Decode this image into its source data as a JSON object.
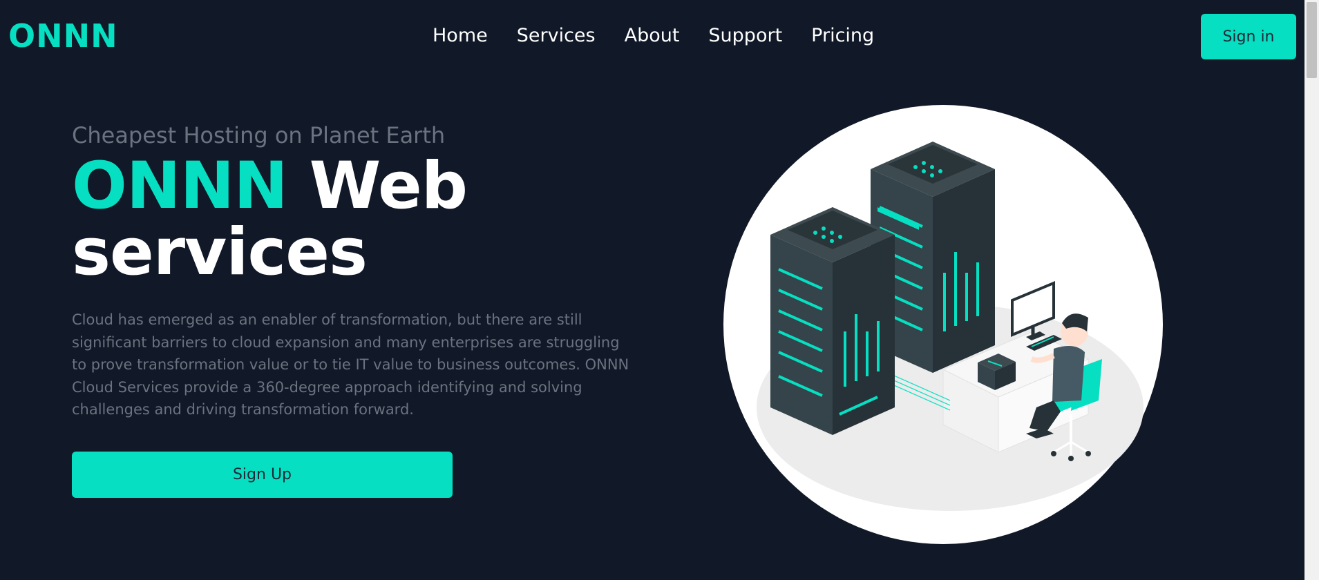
{
  "colors": {
    "accent": "#06dfc1",
    "background": "#111827",
    "text_muted": "#6b7280",
    "button_text": "#1f2937"
  },
  "header": {
    "logo": "ONNN",
    "nav": [
      "Home",
      "Services",
      "About",
      "Support",
      "Pricing"
    ],
    "signin_label": "Sign in"
  },
  "hero": {
    "tagline": "Cheapest Hosting on Planet Earth",
    "headline_brand": "ONNN",
    "headline_rest_1": "Web",
    "headline_rest_2": "services",
    "description": "Cloud has emerged as an enabler of transformation, but there are still significant barriers to cloud expansion and many enterprises are struggling to prove transformation value or to tie IT value to business outcomes. ONNN Cloud Services provide a 360-degree approach identifying and solving challenges and driving transformation forward.",
    "signup_label": "Sign Up"
  },
  "illustration": {
    "icon": "server-room-illustration"
  }
}
